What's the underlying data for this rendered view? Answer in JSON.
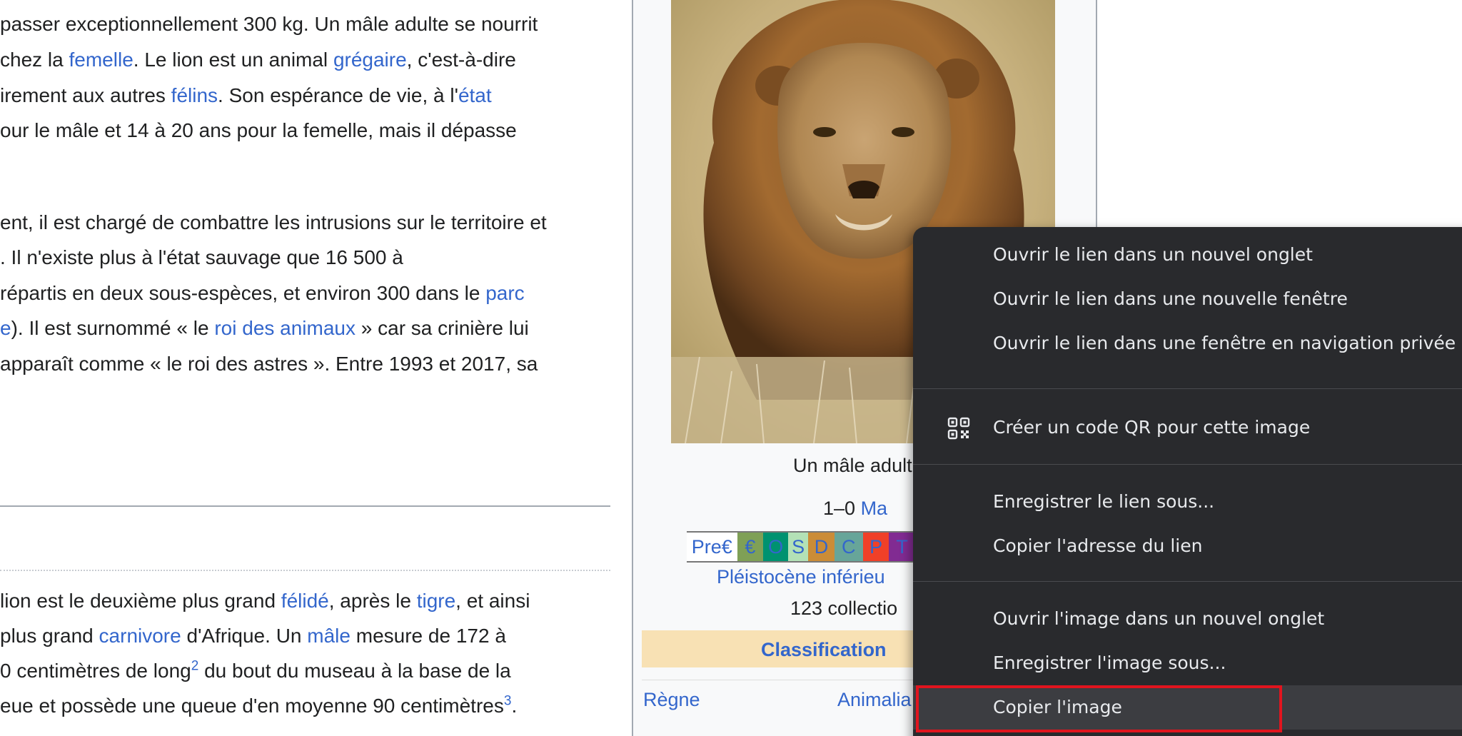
{
  "article": {
    "lines": [
      [
        {
          "t": "passer exceptionnellement 300 kg. Un mâle adulte se nourrit"
        }
      ],
      [
        {
          "t": "chez la "
        },
        {
          "t": "femelle",
          "link": true
        },
        {
          "t": ". Le lion est un animal "
        },
        {
          "t": "grégaire",
          "link": true
        },
        {
          "t": ", c'est-à-dire"
        }
      ],
      [
        {
          "t": "irement aux autres "
        },
        {
          "t": "félins",
          "link": true
        },
        {
          "t": ". Son espérance de vie, à l'"
        },
        {
          "t": "état",
          "link": true
        }
      ],
      [
        {
          "t": "our le mâle et 14 à 20 ans pour la femelle, mais il dépasse"
        }
      ],
      [
        {
          "t": "ent, il est chargé de combattre les intrusions sur le territoire et"
        }
      ],
      [
        {
          "t": ". Il n'existe plus à l'état sauvage que 16 500 à"
        }
      ],
      [
        {
          "t": "répartis en deux sous-espèces, et environ 300 dans le "
        },
        {
          "t": "parc",
          "link": true
        }
      ],
      [
        {
          "t": "e",
          "link": true
        },
        {
          "t": "). Il est surnommé « le "
        },
        {
          "t": "roi des animaux",
          "link": true
        },
        {
          "t": " » car sa crinière lui"
        }
      ],
      [
        {
          "t": "apparaît comme « le roi des astres ». Entre 1993 et 2017, sa"
        }
      ],
      [
        {
          "t": " lion est le deuxième plus grand "
        },
        {
          "t": "félidé",
          "link": true
        },
        {
          "t": ", après le "
        },
        {
          "t": "tigre",
          "link": true
        },
        {
          "t": ", et ainsi"
        }
      ],
      [
        {
          "t": "plus grand "
        },
        {
          "t": "carnivore",
          "link": true
        },
        {
          "t": " d'Afrique. Un "
        },
        {
          "t": "mâle",
          "link": true
        },
        {
          "t": " mesure de 172 à"
        }
      ],
      [
        {
          "t": "0 centimètres de long"
        },
        {
          "t": "2",
          "sup": true
        },
        {
          "t": " du bout du museau à la base de la"
        }
      ],
      [
        {
          "t": "eue et possède une queue d'en moyenne 90 centimètres"
        },
        {
          "t": "3",
          "sup": true
        },
        {
          "t": "."
        }
      ]
    ]
  },
  "infobox": {
    "caption": "Un mâle adult",
    "range_prefix": "1–0 ",
    "range_link": "Ma",
    "timescale": [
      {
        "label": "Pre€",
        "color": "#ffffff"
      },
      {
        "label": "€",
        "color": "#7fa056"
      },
      {
        "label": "O",
        "color": "#009270"
      },
      {
        "label": "S",
        "color": "#b3e1b6"
      },
      {
        "label": "D",
        "color": "#cb8c37"
      },
      {
        "label": "C",
        "color": "#67a599"
      },
      {
        "label": "P",
        "color": "#f04028"
      },
      {
        "label": "T",
        "color": "#812b92"
      }
    ],
    "period_link": "Pléistocène inférieu",
    "collections": "123 collectio",
    "classification_title": "Classification",
    "row_label": "Règne",
    "row_value": "Animalia"
  },
  "context_menu": {
    "items": [
      {
        "label": "Ouvrir le lien dans un nouvel onglet"
      },
      {
        "label": "Ouvrir le lien dans une nouvelle fenêtre"
      },
      {
        "label": "Ouvrir le lien dans une fenêtre en navigation privée"
      },
      {
        "label": "Créer un code QR pour cette image",
        "icon": "qr-code-icon"
      },
      {
        "label": "Enregistrer le lien sous..."
      },
      {
        "label": "Copier l'adresse du lien"
      },
      {
        "label": "Ouvrir l'image dans un nouvel onglet"
      },
      {
        "label": "Enregistrer l'image sous..."
      },
      {
        "label": "Copier l'image",
        "highlighted": true
      }
    ],
    "highlight_color": "#e1141e"
  },
  "colors": {
    "link": "#3366cc",
    "text": "#202122",
    "menu_bg": "#292a2d",
    "menu_text": "#e8eaed",
    "classification_bg": "#f8e1b4"
  }
}
